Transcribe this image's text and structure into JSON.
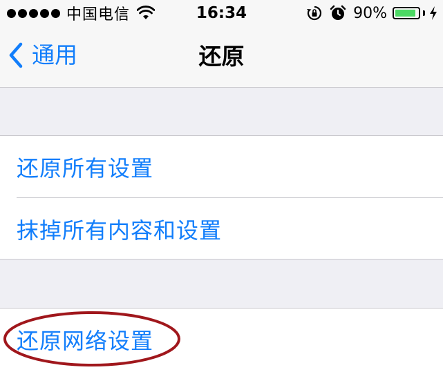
{
  "status_bar": {
    "carrier": "中国电信",
    "time": "16:34",
    "battery_percent": "90%",
    "battery_level": 0.9,
    "icons": [
      "signal-dots-icon",
      "wifi-icon",
      "rotation-lock-icon",
      "alarm-icon",
      "battery-icon",
      "charging-bolt-icon"
    ]
  },
  "nav": {
    "back_label": "通用",
    "title": "还原"
  },
  "groups": [
    {
      "items": [
        {
          "label": "还原所有设置"
        },
        {
          "label": "抹掉所有内容和设置"
        }
      ]
    },
    {
      "items": [
        {
          "label": "还原网络设置"
        }
      ]
    }
  ],
  "colors": {
    "accent": "#127efb",
    "background": "#efeff4",
    "annotation": "#a0171c",
    "battery": "#4cd964"
  }
}
